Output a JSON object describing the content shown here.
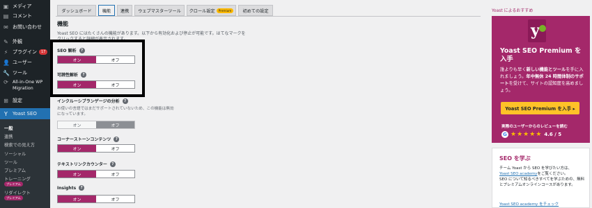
{
  "sidebar": {
    "items": [
      {
        "label": "メディア",
        "icon": "media-icon"
      },
      {
        "label": "コメント",
        "icon": "comment-icon"
      },
      {
        "label": "お問い合わせ",
        "icon": "mail-icon"
      },
      {
        "label": "外観",
        "icon": "appearance-icon"
      },
      {
        "label": "プラグイン",
        "icon": "plugin-icon",
        "badge": "17"
      },
      {
        "label": "ユーザー",
        "icon": "user-icon"
      },
      {
        "label": "ツール",
        "icon": "wrench-icon"
      },
      {
        "label": "All-in-One WP",
        "label2": "Migration",
        "icon": "migration-icon"
      },
      {
        "label": "設定",
        "icon": "settings-icon"
      },
      {
        "label": "Yoast SEO",
        "icon": "yoast-icon"
      }
    ],
    "submenu": [
      "一般",
      "連携",
      "検索での見え方",
      "ソーシャル",
      "ツール",
      "プレミアム",
      "トレーニング",
      "リダイレクト"
    ],
    "submenu_premium_badge": "プレミアム"
  },
  "tabs": [
    "ダッシュボード",
    "機能",
    "連携",
    "ウェブマスターツール",
    "クロール設定",
    "初めての設定"
  ],
  "tab_premium_badge": "Premium",
  "main": {
    "heading": "機能",
    "intro_line1": "Yoast SEO にはたくさんの機能があります。以下から有効化および停止が可能です。はてなマークを",
    "intro_line2": "クリックすると詳細が表示されます。",
    "features": [
      {
        "title": "SEO 解析",
        "on": "オン",
        "off": "オフ",
        "state": "on"
      },
      {
        "title": "可読性解析",
        "on": "オン",
        "off": "オフ",
        "state": "on"
      },
      {
        "title": "インクルーシブランゲージの分析",
        "desc1": "お使いの言語ではまだサポートされていないため、この機能は無効",
        "desc2": "になっています。",
        "on": "オン",
        "off": "オフ",
        "state": "off-disabled"
      },
      {
        "title": "コーナーストーンコンテンツ",
        "on": "オン",
        "off": "オフ",
        "state": "on"
      },
      {
        "title": "テキストリンクカウンター",
        "on": "オン",
        "off": "オフ",
        "state": "on"
      },
      {
        "title": "Insights",
        "on": "オン",
        "off": "オフ",
        "state": "on"
      }
    ],
    "help_glyph": "?"
  },
  "right": {
    "header": "Yoast によるおすすめ",
    "promo": {
      "logo_letter": "y",
      "title": "Yoast SEO Premium を入手",
      "body_pre": "誰よりも早く",
      "body_bold1": "新しい機能とツール",
      "body_mid": "を手に入れましょう。",
      "body_bold2": "年中無休 24 時間体制のサポート",
      "body_post": "を受けて、サイトの認知度を高めましょう。",
      "button": "Yoast SEO Premium を入手 ▸",
      "review_label": "実際のユーザーからのレビューを読む",
      "google_letter": "G",
      "stars": 5,
      "rating": "4.6 / 5"
    },
    "learn": {
      "title": "SEO を学ぶ",
      "line1": "チーム Yoast から SEO を学びたい方は、",
      "link1": "Yoast SEO academy",
      "line1b": "をご覧ください。",
      "line2": "SEO について知るべきすべてを学ぶための、無料とプレミアムオンラインコースがあります。",
      "link_bottom": "Yoast SEO academy をチェック"
    }
  },
  "colors": {
    "accent": "#a4286a",
    "sidebar_bg": "#1d2327",
    "highlight": "#000000",
    "button_yellow": "#fec228"
  }
}
